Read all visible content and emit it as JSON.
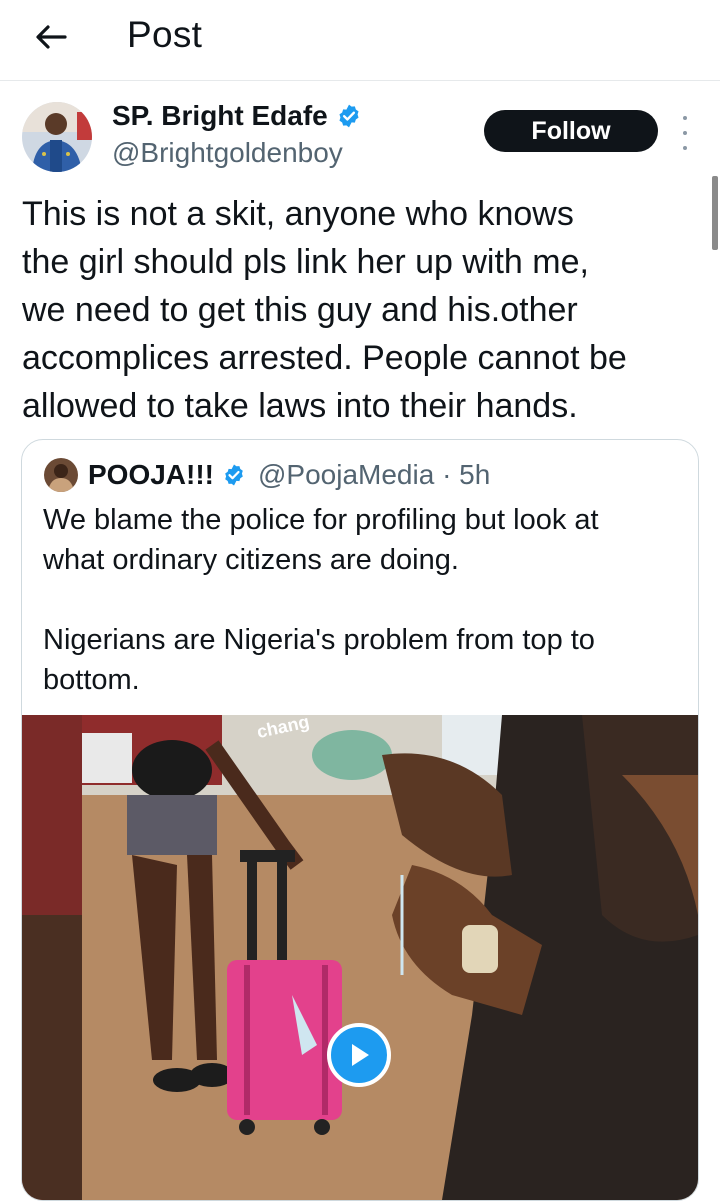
{
  "header": {
    "title": "Post",
    "back_icon": "arrow-left-icon"
  },
  "post": {
    "author_name": "SP. Bright Edafe",
    "author_handle": "@Brightgoldenboy",
    "verified": true,
    "follow_label": "Follow",
    "text": "This is not a skit, anyone who knows\nthe girl should pls link her up with me,\nwe need to get this guy and his.other\naccomplices arrested. People cannot be\nallowed to take laws into their hands."
  },
  "quote": {
    "author_name": "POOJA!!!",
    "verified": true,
    "meta": "@PoojaMedia · 5h",
    "text": "We blame the police for profiling but look at\nwhat ordinary citizens are doing.\n\nNigerians are Nigeria's problem from top to\nbottom.",
    "media_caption": "chang"
  },
  "colors": {
    "accent": "#1d9bf0",
    "text": "#0f1419",
    "secondary": "#536471",
    "border": "#cfd9de"
  }
}
